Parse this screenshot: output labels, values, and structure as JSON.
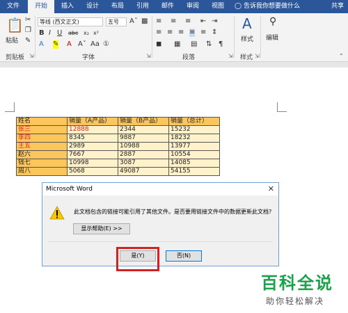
{
  "tabs": [
    "文件",
    "开始",
    "插入",
    "设计",
    "布局",
    "引用",
    "邮件",
    "审阅",
    "视图"
  ],
  "tell_me": "告诉我你想要做什么",
  "share": "共享",
  "clipboard": {
    "paste": "粘贴",
    "label": "剪贴板"
  },
  "font": {
    "name": "等线 (西文正文)",
    "size": "五号",
    "label": "字体"
  },
  "paragraph": {
    "label": "段落"
  },
  "styles": {
    "button": "样式",
    "label": "样式"
  },
  "editing": {
    "button": "编辑"
  },
  "table": {
    "headers": [
      "姓名",
      "销量（A产品）",
      "销量（B产品）",
      "销量（总计）"
    ],
    "rows": [
      [
        "张三",
        "12888",
        "2344",
        "15232"
      ],
      [
        "李四",
        "8345",
        "9887",
        "18232"
      ],
      [
        "王五",
        "2989",
        "10988",
        "13977"
      ],
      [
        "赵六",
        "7667",
        "2887",
        "10554"
      ],
      [
        "钱七",
        "10998",
        "3087",
        "14085"
      ],
      [
        "周八",
        "5068",
        "49087",
        "54155"
      ]
    ]
  },
  "dialog": {
    "title": "Microsoft Word",
    "message": "此文档包含的链接可能引用了其他文件。是否要用链接文件中的数据更新此文档?",
    "help_button": "显示帮助(E) >>",
    "yes_button": "是(Y)",
    "no_button": "否(N)"
  },
  "watermark": {
    "line1": "百科全说",
    "line2": "助你轻松解决"
  },
  "colors": {
    "ribbon_blue": "#2b579a",
    "header_orange": "#fcc65d",
    "cell_light": "#fff1c9",
    "highlight_red": "#d32020",
    "watermark_green": "#1aa14a"
  }
}
